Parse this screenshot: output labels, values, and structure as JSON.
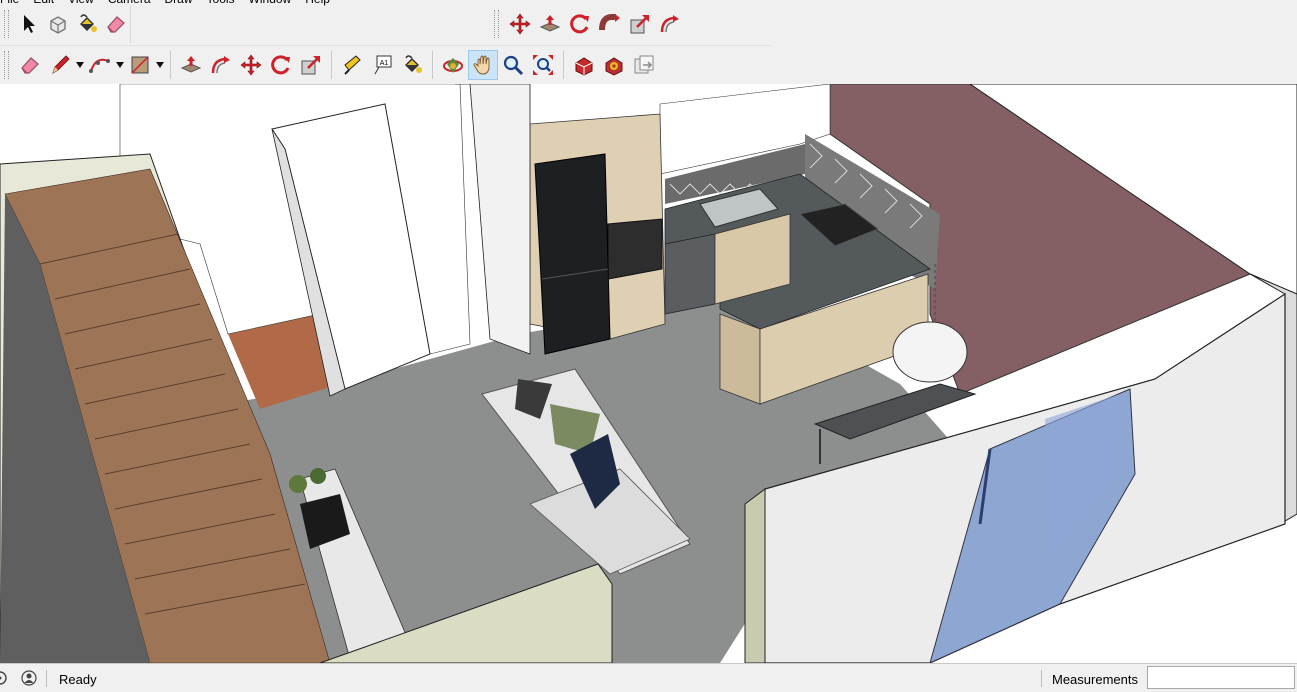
{
  "menu": [
    "File",
    "Edit",
    "View",
    "Camera",
    "Draw",
    "Tools",
    "Window",
    "Help"
  ],
  "toolbar_principal": [
    {
      "name": "select-icon",
      "title": "Select"
    },
    {
      "name": "make-component-icon",
      "title": "Make Component"
    },
    {
      "name": "paint-bucket-icon",
      "title": "Paint Bucket"
    },
    {
      "name": "eraser-icon",
      "title": "Eraser"
    }
  ],
  "toolbar_edit": [
    {
      "name": "move-icon",
      "title": "Move"
    },
    {
      "name": "push-pull-icon",
      "title": "Push/Pull"
    },
    {
      "name": "rotate-icon",
      "title": "Rotate"
    },
    {
      "name": "follow-me-icon",
      "title": "Follow Me"
    },
    {
      "name": "scale-icon",
      "title": "Scale"
    },
    {
      "name": "offset-icon",
      "title": "Offset"
    }
  ],
  "toolbar_large": [
    {
      "name": "eraser-icon",
      "title": "Eraser"
    },
    {
      "name": "pencil-icon",
      "title": "Line",
      "dropdown": true
    },
    {
      "name": "arc-icon",
      "title": "Arc",
      "dropdown": true
    },
    {
      "name": "rectangle-icon",
      "title": "Rectangle",
      "dropdown": true
    },
    {
      "name": "push-pull-icon",
      "title": "Push/Pull"
    },
    {
      "name": "offset-icon",
      "title": "Offset"
    },
    {
      "name": "move-icon",
      "title": "Move"
    },
    {
      "name": "rotate-icon",
      "title": "Rotate"
    },
    {
      "name": "scale-icon",
      "title": "Scale"
    },
    {
      "name": "tape-measure-icon",
      "title": "Tape Measure"
    },
    {
      "name": "text-icon",
      "title": "Text",
      "text": "A1"
    },
    {
      "name": "paint-bucket-icon",
      "title": "Paint Bucket"
    },
    {
      "name": "orbit-icon",
      "title": "Orbit"
    },
    {
      "name": "pan-icon",
      "title": "Pan",
      "active": true
    },
    {
      "name": "zoom-icon",
      "title": "Zoom"
    },
    {
      "name": "zoom-extents-icon",
      "title": "Zoom Extents"
    },
    {
      "name": "warehouse-icon",
      "title": "3D Warehouse"
    },
    {
      "name": "extension-warehouse-icon",
      "title": "Extension Warehouse"
    },
    {
      "name": "layout-icon",
      "title": "Send to LayOut"
    }
  ],
  "status": {
    "ready": "Ready",
    "measurements_label": "Measurements",
    "measurements_value": ""
  },
  "colors": {
    "accent_red": "#d0202a",
    "active_tool_bg": "#cce4f7",
    "wall_mauve": "#845f63",
    "floor_grey": "#8a8c8c",
    "stair_wood": "#a0765a"
  }
}
